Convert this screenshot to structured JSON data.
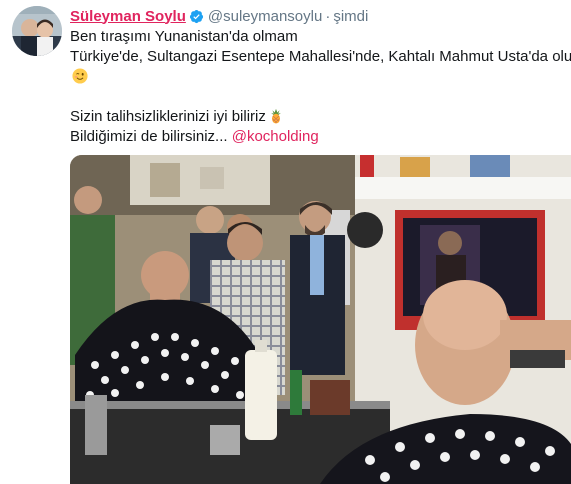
{
  "tweet": {
    "display_name": "Süleyman Soylu",
    "handle": "@suleymansoylu",
    "separator": "·",
    "time": "şimdi",
    "lines": [
      "Ben tıraşımı Yunanistan'da olmam",
      "Türkiye'de, Sultangazi Esentepe Mahallesi'nde, Kahtalı Mahmut Usta'da olurum"
    ],
    "line3": "Sizin talihsizliklerinizi iyi biliriz",
    "line4": "Bildiğimizi de bilirsiniz...",
    "mention": "@kocholding"
  },
  "icons": {
    "verified": "verified-badge-icon",
    "wink": "winking-face-emoji",
    "pineapple": "pineapple-emoji"
  },
  "colors": {
    "link": "#e0245e",
    "verified": "#1da1f2",
    "text": "#14171a",
    "secondary": "#657786"
  }
}
